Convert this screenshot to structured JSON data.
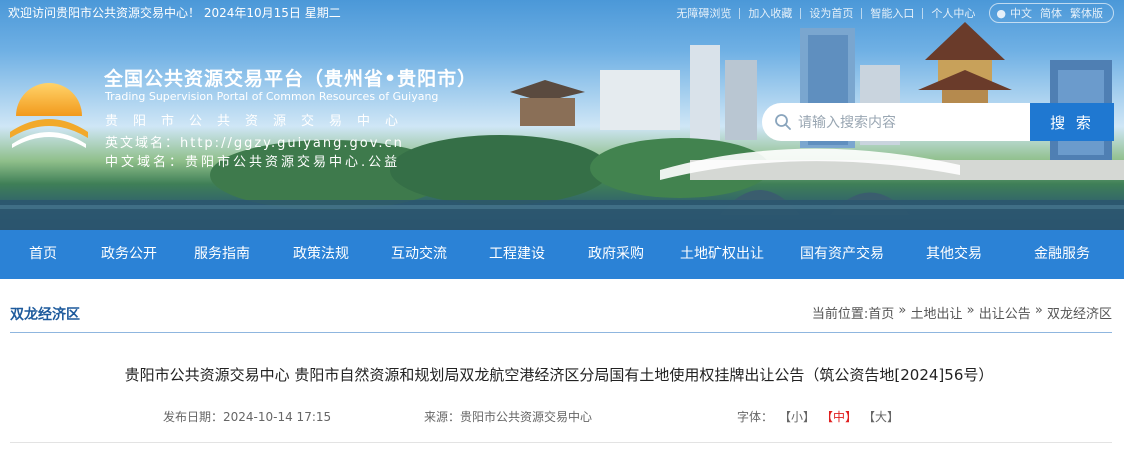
{
  "topbar": {
    "welcome": "欢迎访问贵阳市公共资源交易中心！ 2024年10月15日 星期二",
    "links": [
      "无障碍浏览",
      "加入收藏",
      "设为首页",
      "智能入口",
      "个人中心"
    ],
    "languages": [
      "中文",
      "简体",
      "繁体版"
    ]
  },
  "header": {
    "title": "全国公共资源交易平台（贵州省•贵阳市）",
    "subtitle": "Trading Supervision Portal of Common Resources of Guiyang",
    "org_line": "贵阳市公共资源交易中心",
    "en_domain": "英文域名：http://ggzy.guiyang.gov.cn",
    "cn_domain": "中文域名：贵阳市公共资源交易中心.公益"
  },
  "search": {
    "placeholder": "请输入搜索内容",
    "button_label": "搜 索"
  },
  "nav": {
    "items": [
      "首页",
      "政务公开",
      "服务指南",
      "政策法规",
      "互动交流",
      "工程建设",
      "政府采购",
      "土地矿权出让",
      "国有资产交易",
      "其他交易",
      "金融服务"
    ]
  },
  "section": {
    "title": "双龙经济区",
    "breadcrumb": [
      "当前位置:首页",
      "土地出让",
      "出让公告",
      "双龙经济区"
    ],
    "breadcrumb_sep": "»"
  },
  "article": {
    "title": "贵阳市公共资源交易中心 贵阳市自然资源和规划局双龙航空港经济区分局国有土地使用权挂牌出让公告（筑公资告地[2024]56号）",
    "date_label": "发布日期：2024-10-14 17:15",
    "source_label": "来源：贵阳市公共资源交易中心",
    "font_label": "字体：",
    "font_options": [
      "【小】",
      "【中】",
      "【大】"
    ],
    "font_active": "【中】"
  },
  "colors": {
    "nav_bg": "#2b82d6",
    "search_button": "#1f78d1",
    "section_title": "#1d5a9c",
    "active_font": "#e02020"
  }
}
